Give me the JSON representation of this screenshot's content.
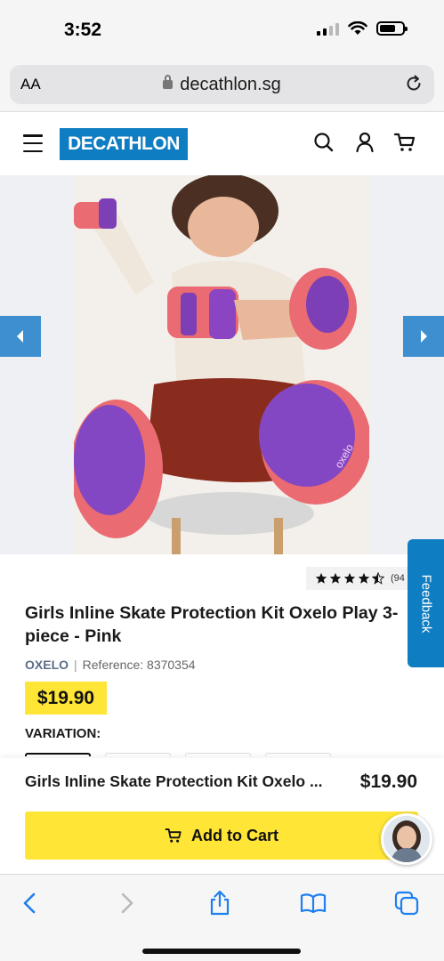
{
  "status_bar": {
    "time": "3:52"
  },
  "browser": {
    "text_size_label": "AA",
    "url": "decathlon.sg"
  },
  "site": {
    "logo_text": "DECATHLON",
    "brand_color": "#0f7dc2",
    "icons": [
      "menu-icon",
      "search-icon",
      "account-icon",
      "cart-icon"
    ]
  },
  "product": {
    "rating_stars": 4.5,
    "rating_count": "(94",
    "title": "Girls Inline Skate Protection Kit Oxelo Play 3-piece - Pink",
    "brand": "OXELO",
    "separator": "|",
    "reference": "Reference: 8370354",
    "price": "$19.90",
    "variation_label": "VARIATION:",
    "image_brand_print": "oxelo"
  },
  "feedback": {
    "label": "Feedback"
  },
  "sticky_bar": {
    "product_name": "Girls Inline Skate Protection Kit Oxelo ...",
    "price": "$19.90",
    "add_to_cart_label": "Add to Cart"
  },
  "colors": {
    "accent_yellow": "#ffe535",
    "arrow_blue": "#3d8fcf",
    "brand_text": "#5a6d87"
  }
}
